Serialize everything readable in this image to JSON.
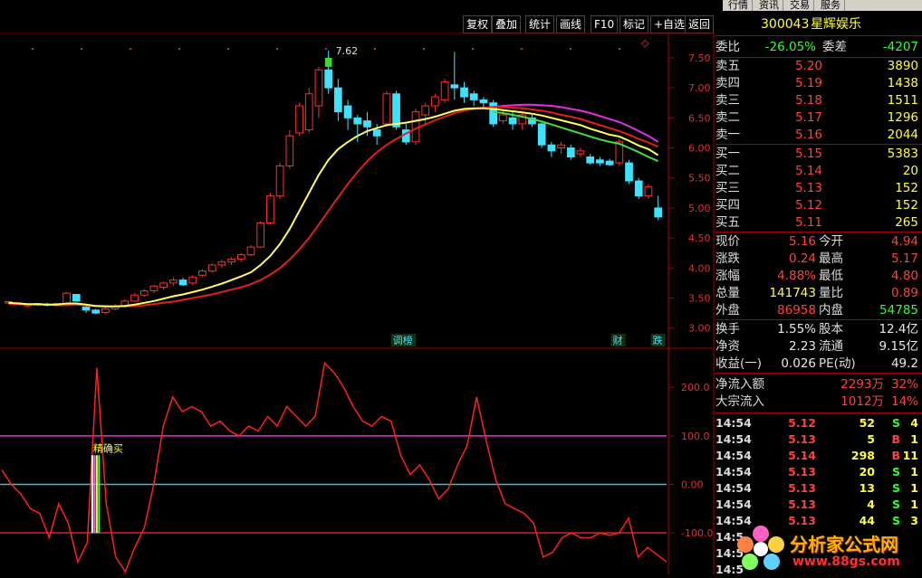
{
  "topnav": [
    "行情",
    "资讯",
    "交易",
    "服务"
  ],
  "toolbar": [
    "复权",
    "叠加",
    "统计",
    "画线",
    "F10",
    "标记",
    "+自选",
    "返回"
  ],
  "stock": {
    "code": "300043",
    "name": "星辉娱乐"
  },
  "webi": {
    "label_a": "委比",
    "value_a": "-26.05%",
    "label_b": "委差",
    "value_b": "-4207"
  },
  "sell": [
    {
      "label": "卖五",
      "price": "5.20",
      "vol": "3890"
    },
    {
      "label": "卖四",
      "price": "5.19",
      "vol": "1438"
    },
    {
      "label": "卖三",
      "price": "5.18",
      "vol": "1511"
    },
    {
      "label": "卖二",
      "price": "5.17",
      "vol": "1296"
    },
    {
      "label": "卖一",
      "price": "5.16",
      "vol": "2044"
    }
  ],
  "buy": [
    {
      "label": "买一",
      "price": "5.15",
      "vol": "5383"
    },
    {
      "label": "买二",
      "price": "5.14",
      "vol": "20"
    },
    {
      "label": "买三",
      "price": "5.13",
      "vol": "152"
    },
    {
      "label": "买四",
      "price": "5.12",
      "vol": "152"
    },
    {
      "label": "买五",
      "price": "5.11",
      "vol": "265"
    }
  ],
  "stats": [
    {
      "l1": "现价",
      "v1": "5.16",
      "l2": "今开",
      "v2": "4.94"
    },
    {
      "l1": "涨跌",
      "v1": "0.24",
      "l2": "最高",
      "v2": "5.17"
    },
    {
      "l1": "涨幅",
      "v1": "4.88%",
      "l2": "最低",
      "v2": "4.80"
    },
    {
      "l1": "总量",
      "v1": "141743",
      "l2": "量比",
      "v2": "0.89"
    },
    {
      "l1": "外盘",
      "v1": "86958",
      "l2": "内盘",
      "v2": "54785"
    }
  ],
  "stats2": [
    {
      "l1": "换手",
      "v1": "1.55%",
      "l2": "股本",
      "v2": "12.4亿"
    },
    {
      "l1": "净资",
      "v1": "2.23",
      "l2": "流通",
      "v2": "9.15亿"
    },
    {
      "l1": "收益(一)",
      "v1": "0.026",
      "l2": "PE(动)",
      "v2": "49.2"
    }
  ],
  "flows": [
    {
      "label": "净流入额",
      "value": "2293万",
      "pct": "32%"
    },
    {
      "label": "大宗流入",
      "value": "1012万",
      "pct": "14%"
    }
  ],
  "ticks": [
    {
      "time": "14:54",
      "price": "5.12",
      "vol": "52",
      "side": "S",
      "n": "4"
    },
    {
      "time": "14:54",
      "price": "5.13",
      "vol": "5",
      "side": "B",
      "n": "1"
    },
    {
      "time": "14:54",
      "price": "5.14",
      "vol": "298",
      "side": "B",
      "n": "11"
    },
    {
      "time": "14:54",
      "price": "5.13",
      "vol": "20",
      "side": "S",
      "n": "1"
    },
    {
      "time": "14:54",
      "price": "5.13",
      "vol": "13",
      "side": "S",
      "n": "1"
    },
    {
      "time": "14:54",
      "price": "5.13",
      "vol": "4",
      "side": "S",
      "n": "1"
    },
    {
      "time": "14:54",
      "price": "5.13",
      "vol": "44",
      "side": "S",
      "n": "3"
    },
    {
      "time": "14:5",
      "price": "",
      "vol": "",
      "side": "",
      "n": ""
    },
    {
      "time": "14:5",
      "price": "",
      "vol": "",
      "side": "",
      "n": ""
    },
    {
      "time": "14:5",
      "price": "",
      "vol": "",
      "side": "",
      "n": ""
    }
  ],
  "logo": {
    "text": "分析家公式网",
    "url": "www.88gs.com"
  },
  "colors": {
    "up": "#ff3030",
    "down": "#40e0ff",
    "ma1": "#ffff60",
    "ma2": "#e02020",
    "ma3": "#e030e0",
    "ma4": "#40e040",
    "line100": "#e030e0",
    "line0": "#40c0d0",
    "lineneg": "#e02020"
  },
  "chart_data": [
    {
      "type": "candlestick",
      "ylim": [
        2.8,
        7.8
      ],
      "yticks": [
        "7.50",
        "7.00",
        "6.50",
        "6.00",
        "5.50",
        "5.00",
        "4.50",
        "4.00",
        "3.50",
        "3.00"
      ],
      "high_label": "7.62",
      "markers": [
        {
          "text": "调榜",
          "pos": 0.6
        },
        {
          "text": "财",
          "pos": 0.93
        },
        {
          "text": "跌",
          "pos": 0.99
        }
      ],
      "candles": [
        [
          3.42,
          3.44,
          3.4,
          3.45
        ],
        [
          3.42,
          3.42,
          3.38,
          3.43
        ],
        [
          3.37,
          3.4,
          3.34,
          3.41
        ],
        [
          3.38,
          3.41,
          3.36,
          3.42
        ],
        [
          3.4,
          3.38,
          3.36,
          3.42
        ],
        [
          3.38,
          3.41,
          3.36,
          3.42
        ],
        [
          3.41,
          3.58,
          3.4,
          3.6
        ],
        [
          3.56,
          3.45,
          3.44,
          3.57
        ],
        [
          3.35,
          3.3,
          3.25,
          3.37
        ],
        [
          3.3,
          3.25,
          3.23,
          3.32
        ],
        [
          3.26,
          3.32,
          3.24,
          3.34
        ],
        [
          3.32,
          3.36,
          3.3,
          3.4
        ],
        [
          3.36,
          3.45,
          3.34,
          3.48
        ],
        [
          3.45,
          3.55,
          3.44,
          3.58
        ],
        [
          3.55,
          3.62,
          3.52,
          3.65
        ],
        [
          3.62,
          3.7,
          3.58,
          3.72
        ],
        [
          3.68,
          3.75,
          3.64,
          3.78
        ],
        [
          3.75,
          3.8,
          3.7,
          3.85
        ],
        [
          3.8,
          3.72,
          3.7,
          3.84
        ],
        [
          3.75,
          3.85,
          3.72,
          3.88
        ],
        [
          3.88,
          3.95,
          3.85,
          3.98
        ],
        [
          3.95,
          4.05,
          3.92,
          4.08
        ],
        [
          4.05,
          4.1,
          4.0,
          4.14
        ],
        [
          4.1,
          4.15,
          4.05,
          4.18
        ],
        [
          4.15,
          4.22,
          4.1,
          4.25
        ],
        [
          4.22,
          4.35,
          4.2,
          4.38
        ],
        [
          4.35,
          4.75,
          4.33,
          4.78
        ],
        [
          4.75,
          5.2,
          4.72,
          5.25
        ],
        [
          5.2,
          5.7,
          5.15,
          5.75
        ],
        [
          5.7,
          6.2,
          5.65,
          6.3
        ],
        [
          6.25,
          6.7,
          6.2,
          6.75
        ],
        [
          6.3,
          6.9,
          6.25,
          7.0
        ],
        [
          6.7,
          7.3,
          6.5,
          7.35
        ],
        [
          7.3,
          7.0,
          6.9,
          7.62
        ],
        [
          7.0,
          6.6,
          6.45,
          7.15
        ],
        [
          6.7,
          6.5,
          6.3,
          6.8
        ],
        [
          6.5,
          6.4,
          6.1,
          6.55
        ],
        [
          6.45,
          6.35,
          6.2,
          6.6
        ],
        [
          6.3,
          6.2,
          6.05,
          6.4
        ],
        [
          6.4,
          6.9,
          6.35,
          6.95
        ],
        [
          6.9,
          6.35,
          6.3,
          6.95
        ],
        [
          6.3,
          6.1,
          6.05,
          6.4
        ],
        [
          6.1,
          6.6,
          6.05,
          6.65
        ],
        [
          6.55,
          6.7,
          6.4,
          6.75
        ],
        [
          6.7,
          6.85,
          6.6,
          6.9
        ],
        [
          6.8,
          7.1,
          6.75,
          7.15
        ],
        [
          7.05,
          7.0,
          6.8,
          7.6
        ],
        [
          7.0,
          6.85,
          6.75,
          7.1
        ],
        [
          6.9,
          6.8,
          6.7,
          6.95
        ],
        [
          6.8,
          6.75,
          6.65,
          6.85
        ],
        [
          6.75,
          6.4,
          6.35,
          6.8
        ],
        [
          6.45,
          6.55,
          6.4,
          6.65
        ],
        [
          6.5,
          6.4,
          6.3,
          6.6
        ],
        [
          6.4,
          6.55,
          6.3,
          6.6
        ],
        [
          6.5,
          6.4,
          6.35,
          6.55
        ],
        [
          6.4,
          6.05,
          6.0,
          6.45
        ],
        [
          6.05,
          5.95,
          5.85,
          6.1
        ],
        [
          6.0,
          6.05,
          5.9,
          6.1
        ],
        [
          6.0,
          5.85,
          5.8,
          6.05
        ],
        [
          5.9,
          5.95,
          5.85,
          6.0
        ],
        [
          5.85,
          5.75,
          5.72,
          5.9
        ],
        [
          5.8,
          5.75,
          5.7,
          5.85
        ],
        [
          5.78,
          5.72,
          5.7,
          5.82
        ],
        [
          5.75,
          6.1,
          5.7,
          6.15
        ],
        [
          5.75,
          5.45,
          5.4,
          5.8
        ],
        [
          5.45,
          5.2,
          5.15,
          5.5
        ],
        [
          5.2,
          5.35,
          5.15,
          5.4
        ],
        [
          5.0,
          4.85,
          4.8,
          5.2
        ]
      ],
      "ma_short": [
        3.42,
        3.41,
        3.4,
        3.4,
        3.39,
        3.39,
        3.41,
        3.41,
        3.39,
        3.37,
        3.36,
        3.36,
        3.37,
        3.39,
        3.42,
        3.45,
        3.49,
        3.53,
        3.56,
        3.6,
        3.64,
        3.69,
        3.74,
        3.8,
        3.86,
        3.93,
        4.05,
        4.2,
        4.4,
        4.65,
        4.95,
        5.25,
        5.55,
        5.8,
        5.98,
        6.1,
        6.2,
        6.28,
        6.33,
        6.38,
        6.4,
        6.42,
        6.45,
        6.48,
        6.52,
        6.57,
        6.62,
        6.65,
        6.66,
        6.66,
        6.65,
        6.63,
        6.61,
        6.59,
        6.57,
        6.54,
        6.5,
        6.46,
        6.42,
        6.38,
        6.32,
        6.27,
        6.22,
        6.19,
        6.12,
        6.04,
        5.98,
        5.88
      ],
      "ma_long": [
        3.4,
        3.4,
        3.39,
        3.39,
        3.39,
        3.38,
        3.38,
        3.39,
        3.38,
        3.37,
        3.37,
        3.36,
        3.36,
        3.37,
        3.38,
        3.4,
        3.42,
        3.44,
        3.47,
        3.5,
        3.53,
        3.56,
        3.6,
        3.64,
        3.68,
        3.73,
        3.8,
        3.89,
        4.0,
        4.14,
        4.31,
        4.5,
        4.72,
        4.95,
        5.18,
        5.4,
        5.6,
        5.78,
        5.93,
        6.05,
        6.15,
        6.24,
        6.32,
        6.39,
        6.46,
        6.52,
        6.58,
        6.62,
        6.65,
        6.67,
        6.68,
        6.68,
        6.67,
        6.66,
        6.64,
        6.62,
        6.59,
        6.55,
        6.52,
        6.48,
        6.43,
        6.38,
        6.33,
        6.28,
        6.22,
        6.15,
        6.09,
        6.02
      ],
      "ma_c": [
        null,
        null,
        null,
        null,
        null,
        null,
        null,
        null,
        null,
        null,
        null,
        null,
        null,
        null,
        null,
        null,
        null,
        null,
        null,
        null,
        null,
        null,
        null,
        null,
        null,
        null,
        null,
        null,
        null,
        null,
        null,
        null,
        null,
        null,
        null,
        null,
        null,
        null,
        null,
        null,
        null,
        null,
        null,
        null,
        null,
        null,
        null,
        null,
        null,
        null,
        6.68,
        6.7,
        6.71,
        6.72,
        6.72,
        6.71,
        6.7,
        6.68,
        6.65,
        6.62,
        6.58,
        6.53,
        6.48,
        6.43,
        6.36,
        6.28,
        6.2,
        6.1
      ],
      "ma_d": [
        null,
        null,
        null,
        null,
        null,
        null,
        null,
        null,
        null,
        null,
        null,
        null,
        null,
        null,
        null,
        null,
        null,
        null,
        null,
        null,
        null,
        null,
        null,
        null,
        null,
        null,
        null,
        null,
        null,
        null,
        null,
        null,
        null,
        null,
        null,
        null,
        null,
        null,
        null,
        null,
        null,
        null,
        null,
        null,
        null,
        null,
        null,
        null,
        null,
        null,
        6.6,
        6.58,
        6.55,
        6.52,
        6.48,
        6.44,
        6.39,
        6.34,
        6.29,
        6.24,
        6.19,
        6.14,
        6.1,
        6.07,
        6.0,
        5.93,
        5.85,
        5.78
      ]
    },
    {
      "type": "line",
      "ylim": [
        -180,
        260
      ],
      "yticks": [
        "200.0",
        "100.0",
        "0.00",
        "-100.0"
      ],
      "hlines": [
        100,
        0,
        -100
      ],
      "annotation": "精确买",
      "values": [
        30,
        0,
        -20,
        -50,
        -60,
        -110,
        -40,
        -80,
        -160,
        -120,
        240,
        -40,
        -150,
        -180,
        -130,
        -90,
        0,
        120,
        180,
        150,
        160,
        150,
        120,
        130,
        110,
        100,
        120,
        110,
        140,
        120,
        160,
        140,
        120,
        140,
        250,
        230,
        200,
        160,
        130,
        120,
        140,
        130,
        60,
        20,
        40,
        10,
        -30,
        -10,
        40,
        80,
        180,
        90,
        10,
        -40,
        -50,
        -60,
        -80,
        -150,
        -140,
        -110,
        -100,
        -110,
        -110,
        -100,
        -105,
        -100,
        -70,
        -150,
        -130,
        -145,
        -160
      ]
    }
  ]
}
